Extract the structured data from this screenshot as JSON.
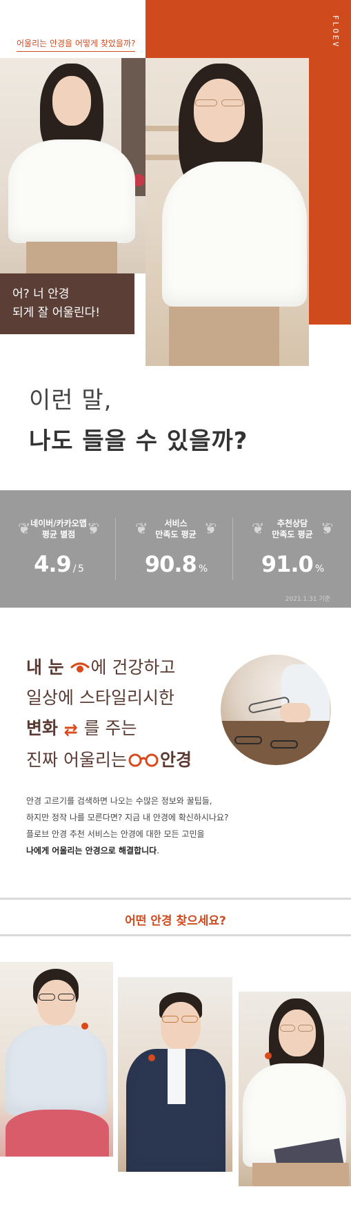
{
  "hero": {
    "brand": "FLOEV",
    "question": "어울리는 안경을 어떻게 찾았을까?",
    "quote_line1": "어? 너 안경",
    "quote_line2": "되게 잘 어울린다!",
    "headline_line1": "이런 말,",
    "headline_line2": "나도 들을 수 있을까?"
  },
  "stats": {
    "items": [
      {
        "label_line1": "네이버/카카오맵",
        "label_line2": "평균 별점",
        "value": "4.9",
        "unit": "/ 5"
      },
      {
        "label_line1": "서비스",
        "label_line2": "만족도 평균",
        "value": "90.8",
        "unit": "%"
      },
      {
        "label_line1": "추천상담",
        "label_line2": "만족도 평균",
        "value": "91.0",
        "unit": "%"
      }
    ],
    "date_note": "2021.1.31 기준"
  },
  "feature": {
    "line1_a": "내 눈",
    "line1_b": "에 건강하고",
    "line2": "일상에 스타일리시한",
    "line3_a": "변화",
    "line3_b": "를 주는",
    "line4_a": "진짜 어울리는",
    "line4_b": "안경",
    "icons": [
      "eye-icon",
      "swap-arrows-icon",
      "glasses-icon"
    ],
    "accent_color": "#d84a1b"
  },
  "description": {
    "line1": "안경 고르기를 검색하면 나오는 수많은 정보와 꿀팁들,",
    "line2": "하지만 정작 나를 모른다면? 지금 내 안경에 확신하시나요?",
    "line3": "플로브 안경 추천 서비스는 안경에 대한 모든 고민을",
    "line4_strong": "나에게 어울리는 안경으로 해결합니다",
    "line4_end": "."
  },
  "question_bar": {
    "text": "어떤 안경 찾으세요?"
  },
  "colors": {
    "brand_orange": "#cf4a1d",
    "quote_bg": "#5b3f36",
    "stats_bg": "#9b9b9b"
  }
}
